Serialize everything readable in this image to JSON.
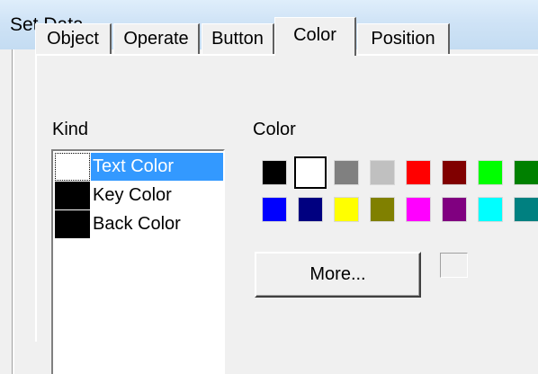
{
  "window": {
    "title": "Set Data"
  },
  "tabs": [
    {
      "label": "Object"
    },
    {
      "label": "Operate"
    },
    {
      "label": "Button"
    },
    {
      "label": "Color",
      "active": true
    },
    {
      "label": "Position"
    }
  ],
  "kind": {
    "label": "Kind",
    "selected": "Text Color",
    "items": [
      {
        "label": "Text Color",
        "color": "#ffffff"
      },
      {
        "label": "Key Color",
        "color": "#000000"
      },
      {
        "label": "Back Color",
        "color": "#000000"
      }
    ]
  },
  "color": {
    "label": "Color",
    "selected": "#ffffff",
    "palette": [
      "#000000",
      "#ffffff",
      "#808080",
      "#c0c0c0",
      "#ff0000",
      "#800000",
      "#00ff00",
      "#008000",
      "#0000ff",
      "#000080",
      "#ffff00",
      "#808000",
      "#ff00ff",
      "#800080",
      "#00ffff",
      "#008080"
    ],
    "more_label": "More..."
  }
}
